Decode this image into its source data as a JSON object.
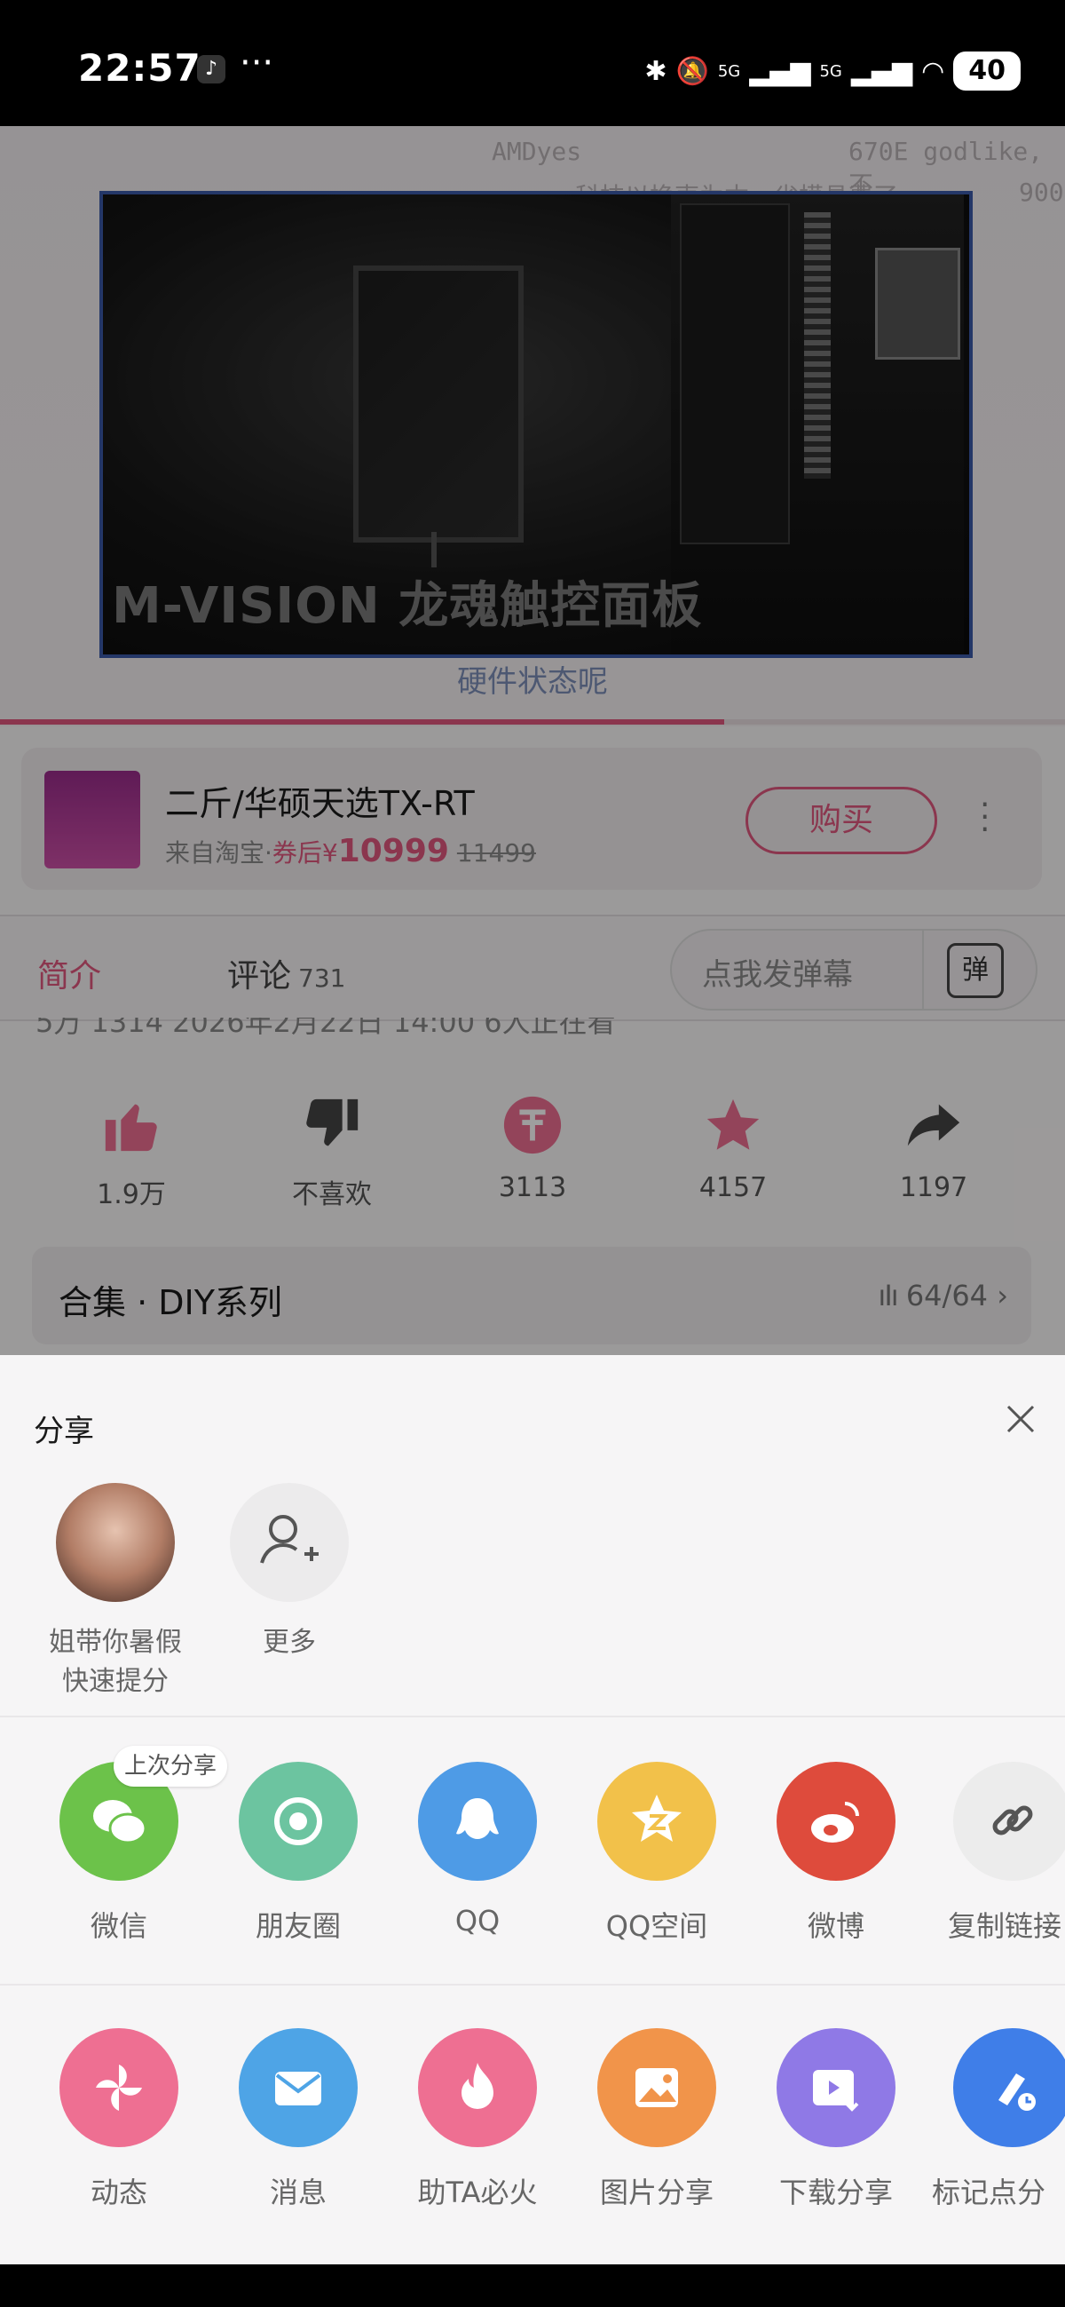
{
  "status_bar": {
    "time": "22:57",
    "overflow": "···",
    "network1": "5G",
    "network2": "5G",
    "battery": "40"
  },
  "video": {
    "danmaku": [
      {
        "text": "AMDyes"
      },
      {
        "text": "670E godlike, 不"
      },
      {
        "text": "科技以换壳为本，省模具费了"
      },
      {
        "text": "900"
      }
    ],
    "frame_text": "M-VISION 龙魂触控面板",
    "caption": "硬件状态呢",
    "progress": 0.68
  },
  "product": {
    "title": "二斤/华硕天选TX-RT",
    "from": "来自淘宝·",
    "coupon": "券后¥",
    "price": "10999",
    "original": "11499",
    "buy_label": "购买"
  },
  "tabs": {
    "intro": "简介",
    "comments": "评论",
    "comments_count": "731",
    "danmaku_placeholder": "点我发弹幕",
    "danmaku_icon": "弹"
  },
  "meta_line": "5万  1314  2026年2月22日 14:00  6人正在看",
  "actions": [
    {
      "icon": "thumbs-up-icon",
      "label": "1.9万"
    },
    {
      "icon": "thumbs-down-icon",
      "label": "不喜欢"
    },
    {
      "icon": "coin-icon",
      "label": "3113"
    },
    {
      "icon": "star-icon",
      "label": "4157"
    },
    {
      "icon": "share-arrow-icon",
      "label": "1197"
    }
  ],
  "collection": {
    "title": "合集 · DIY系列",
    "progress": "64/64"
  },
  "share_sheet": {
    "title": "分享",
    "contacts": [
      {
        "label_line1": "姐带你暑假",
        "label_line2": "快速提分"
      },
      {
        "label_line1": "更多",
        "label_line2": ""
      }
    ],
    "last_share_badge": "上次分享",
    "row1": [
      {
        "icon": "wechat-icon",
        "label": "微信",
        "color": "#6cc24a"
      },
      {
        "icon": "moments-icon",
        "label": "朋友圈",
        "color": "#6cc4a0"
      },
      {
        "icon": "qq-icon",
        "label": "QQ",
        "color": "#4e9be6"
      },
      {
        "icon": "qzone-icon",
        "label": "QQ空间",
        "color": "#f2c14a"
      },
      {
        "icon": "weibo-icon",
        "label": "微博",
        "color": "#de4b3c"
      },
      {
        "icon": "link-icon",
        "label": "复制链接",
        "color": "#ececec"
      }
    ],
    "row2": [
      {
        "icon": "pinwheel-icon",
        "label": "动态",
        "color": "#ee6f92"
      },
      {
        "icon": "mail-icon",
        "label": "消息",
        "color": "#4ea4e6"
      },
      {
        "icon": "fire-icon",
        "label": "助TA必火",
        "color": "#ee6f92"
      },
      {
        "icon": "image-icon",
        "label": "图片分享",
        "color": "#f1944a"
      },
      {
        "icon": "download-video-icon",
        "label": "下载分享",
        "color": "#8f79e6"
      },
      {
        "icon": "mark-point-icon",
        "label": "标记点分",
        "color": "#3f7ee8"
      }
    ]
  }
}
